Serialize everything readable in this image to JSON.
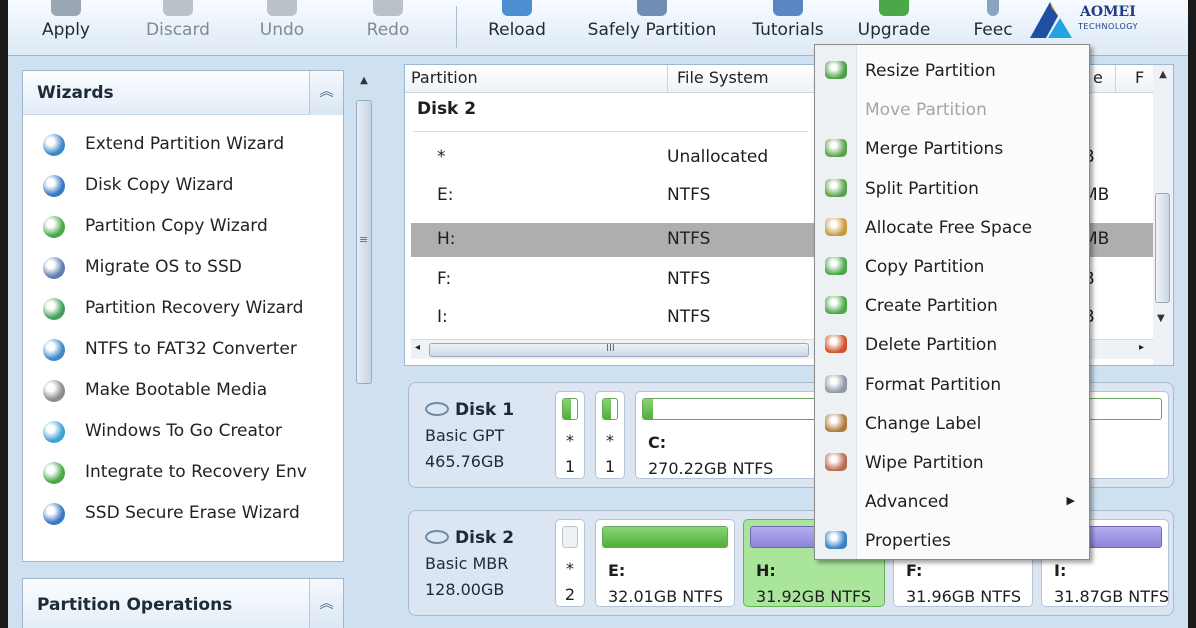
{
  "toolbar": {
    "apply": "Apply",
    "discard": "Discard",
    "undo": "Undo",
    "redo": "Redo",
    "reload": "Reload",
    "safely_partition": "Safely Partition",
    "tutorials": "Tutorials",
    "upgrade": "Upgrade",
    "feedback_partial": "Feec"
  },
  "logo": {
    "brand": "AOMEI",
    "sub": "TECHNOLOGY"
  },
  "wizards": {
    "title": "Wizards",
    "collapse_glyph": "︽",
    "items": [
      {
        "label": "Extend Partition Wizard",
        "icon": "disk-extend-icon",
        "color": "#3f88c7"
      },
      {
        "label": "Disk Copy Wizard",
        "icon": "disk-copy-icon",
        "color": "#3a78c2"
      },
      {
        "label": "Partition Copy Wizard",
        "icon": "partition-copy-icon",
        "color": "#4aa848"
      },
      {
        "label": "Migrate OS to SSD",
        "icon": "migrate-os-icon",
        "color": "#5d7fb0"
      },
      {
        "label": "Partition Recovery Wizard",
        "icon": "partition-recovery-icon",
        "color": "#43a05b"
      },
      {
        "label": "NTFS to FAT32 Converter",
        "icon": "converter-icon",
        "color": "#3f88c7"
      },
      {
        "label": "Make Bootable Media",
        "icon": "bootable-media-icon",
        "color": "#8c8c8c"
      },
      {
        "label": "Windows To Go Creator",
        "icon": "windows-to-go-icon",
        "color": "#3ea1d6"
      },
      {
        "label": "Integrate to Recovery Env",
        "icon": "recovery-env-icon",
        "color": "#4aa848"
      },
      {
        "label": "SSD Secure Erase Wizard",
        "icon": "secure-erase-icon",
        "color": "#3a78c2"
      }
    ]
  },
  "partition_operations": {
    "title": "Partition Operations",
    "collapse_glyph": "︽"
  },
  "table": {
    "headers": {
      "partition": "Partition",
      "file_system": "File System",
      "capacity_partial": "e",
      "flags_partial": "F"
    },
    "group_label": "Disk 2",
    "rows": [
      {
        "partition": "*",
        "file_system": "Unallocated",
        "tail": "B"
      },
      {
        "partition": "E:",
        "file_system": "NTFS",
        "tail": "MB"
      },
      {
        "partition": "H:",
        "file_system": "NTFS",
        "tail": "MB"
      },
      {
        "partition": "F:",
        "file_system": "NTFS",
        "tail": "B"
      },
      {
        "partition": "I:",
        "file_system": "NTFS",
        "tail": "B"
      }
    ],
    "scroll_grip": "III"
  },
  "disk_map": {
    "disk1": {
      "name": "Disk 1",
      "type": "Basic GPT",
      "size": "465.76GB",
      "partitions": [
        {
          "star": "*",
          "num": "1",
          "fill": 0.6
        },
        {
          "star": "*",
          "num": "1",
          "fill": 0.6
        },
        {
          "letter": "C:",
          "info": "270.22GB NTFS",
          "fill": 0.02
        }
      ]
    },
    "disk2": {
      "name": "Disk 2",
      "type": "Basic MBR",
      "size": "128.00GB",
      "partitions": [
        {
          "star": "*",
          "num": "2",
          "fill": 0
        },
        {
          "letter": "E:",
          "info": "32.01GB NTFS",
          "fill": 1.0
        },
        {
          "letter": "H:",
          "info": "31.92GB NTFS",
          "fill": 1.0
        },
        {
          "letter": "F:",
          "info": "31.96GB NTFS",
          "fill": 1.0
        },
        {
          "letter": "I:",
          "info": "31.87GB NTFS",
          "fill": 1.0
        }
      ]
    }
  },
  "context_menu": {
    "items": [
      {
        "label": "Resize Partition",
        "icon": "resize-icon",
        "color": "#4f9f4a",
        "enabled": true
      },
      {
        "label": "Move Partition",
        "icon": "",
        "color": "",
        "enabled": false
      },
      {
        "label": "Merge Partitions",
        "icon": "merge-icon",
        "color": "#5aa24d",
        "enabled": true
      },
      {
        "label": "Split Partition",
        "icon": "split-icon",
        "color": "#5aa24d",
        "enabled": true
      },
      {
        "label": "Allocate Free Space",
        "icon": "allocate-icon",
        "color": "#c79a3a",
        "enabled": true
      },
      {
        "label": "Copy Partition",
        "icon": "copy-icon",
        "color": "#4aa848",
        "enabled": true
      },
      {
        "label": "Create Partition",
        "icon": "create-icon",
        "color": "#4aa848",
        "enabled": true
      },
      {
        "label": "Delete Partition",
        "icon": "delete-icon",
        "color": "#d0532f",
        "enabled": true
      },
      {
        "label": "Format Partition",
        "icon": "format-icon",
        "color": "#8e9aa8",
        "enabled": true
      },
      {
        "label": "Change Label",
        "icon": "label-icon",
        "color": "#b07a3c",
        "enabled": true
      },
      {
        "label": "Wipe Partition",
        "icon": "wipe-icon",
        "color": "#b86b52",
        "enabled": true
      },
      {
        "label": "Advanced",
        "icon": "",
        "color": "",
        "enabled": true,
        "submenu": true
      },
      {
        "label": "Properties",
        "icon": "info-icon",
        "color": "#3b7fc4",
        "enabled": true
      }
    ]
  },
  "colors": {
    "accent_green": "#4fae38",
    "selected_row": "#aeaeae",
    "selected_block": "#a9e69b"
  }
}
